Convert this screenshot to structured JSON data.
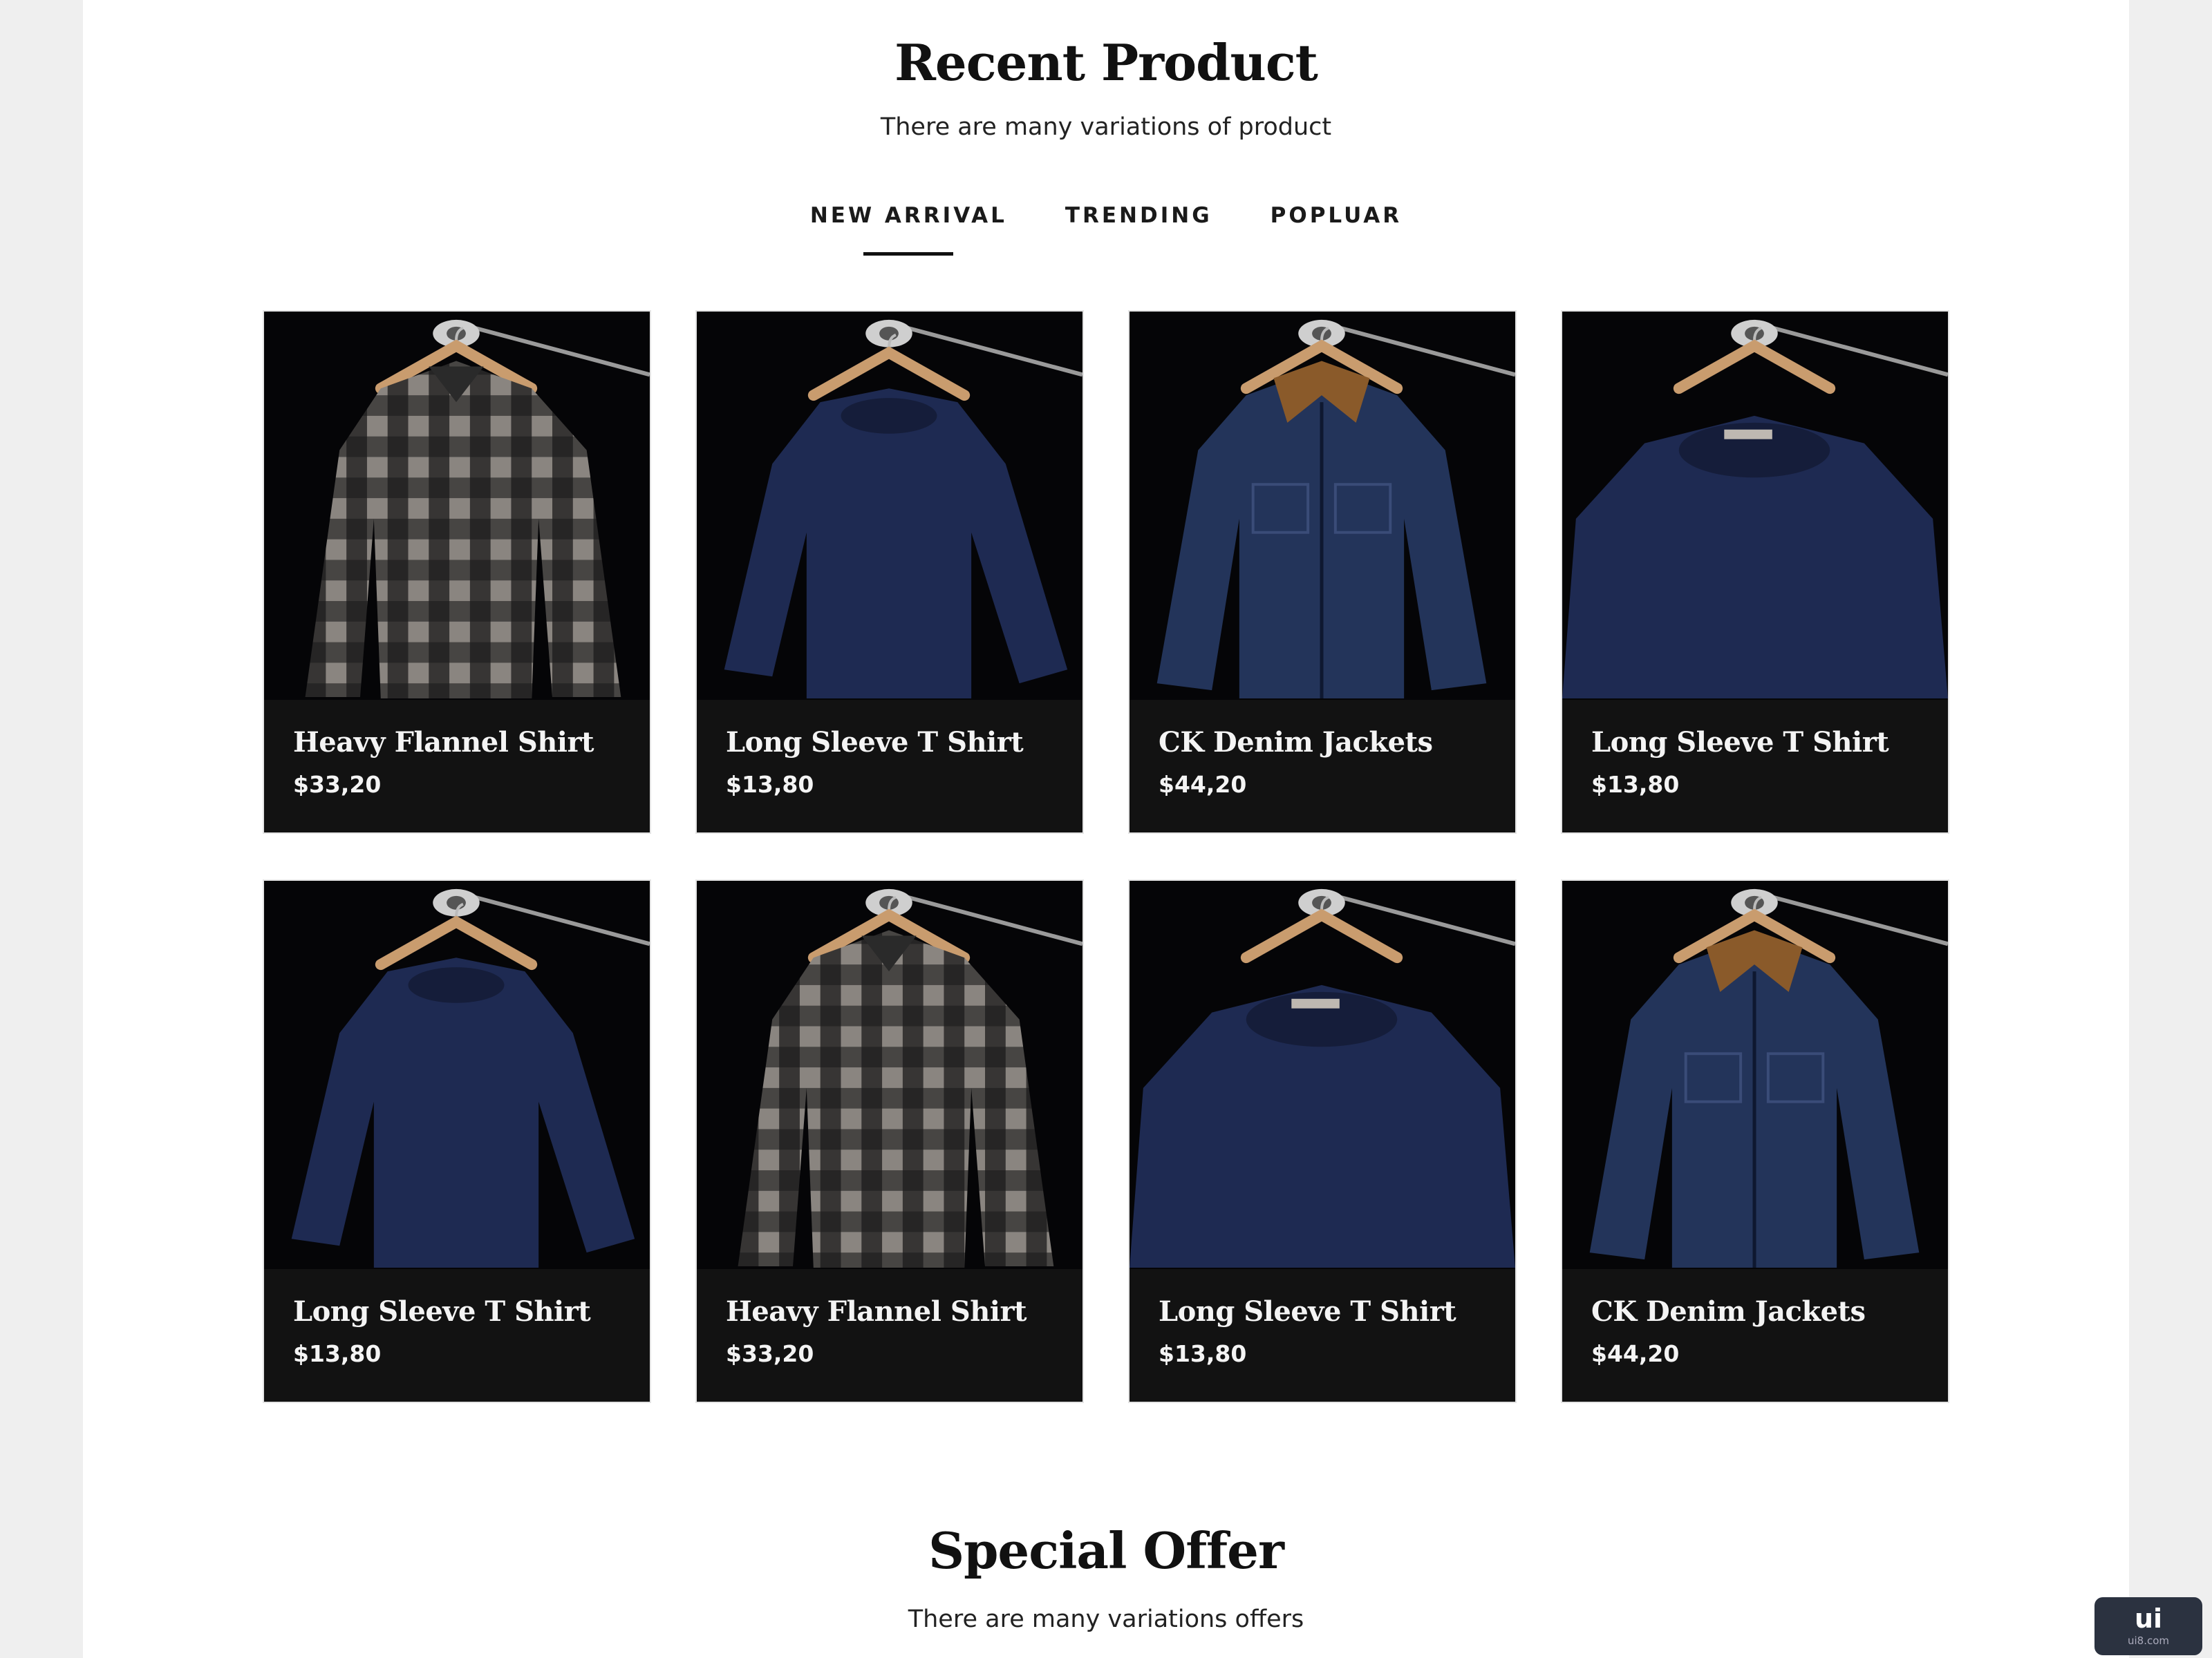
{
  "recent": {
    "title": "Recent Product",
    "subtitle": "There are many variations of product",
    "tabs": [
      {
        "label": "NEW ARRIVAL",
        "active": true
      },
      {
        "label": "TRENDING",
        "active": false
      },
      {
        "label": "POPLUAR",
        "active": false
      }
    ],
    "products": [
      {
        "name": "Heavy Flannel Shirt",
        "price": "$33,20",
        "image": "flannel-shirt"
      },
      {
        "name": "Long Sleeve T Shirt",
        "price": "$13,80",
        "image": "navy-sweater"
      },
      {
        "name": "CK Denim Jackets",
        "price": "$44,20",
        "image": "denim-jacket"
      },
      {
        "name": "Long Sleeve T Shirt",
        "price": "$13,80",
        "image": "navy-sweater-close"
      },
      {
        "name": "Long Sleeve T Shirt",
        "price": "$13,80",
        "image": "navy-sweater"
      },
      {
        "name": "Heavy Flannel Shirt",
        "price": "$33,20",
        "image": "flannel-shirt"
      },
      {
        "name": "Long Sleeve T Shirt",
        "price": "$13,80",
        "image": "navy-sweater-close"
      },
      {
        "name": "CK Denim Jackets",
        "price": "$44,20",
        "image": "denim-jacket"
      }
    ]
  },
  "special": {
    "title": "Special Offer",
    "subtitle": "There are many variations offers"
  },
  "watermark": {
    "main": "ui",
    "sub": "ui8.com"
  },
  "colors": {
    "card_bg": "#121212",
    "page_bg": "#ffffff",
    "outer_bg": "#efefef",
    "denim": "#23345a",
    "navy": "#1e2a52",
    "flannel_light": "#8a8580",
    "collar": "#8a5a2a",
    "hanger": "#c99c6e"
  }
}
